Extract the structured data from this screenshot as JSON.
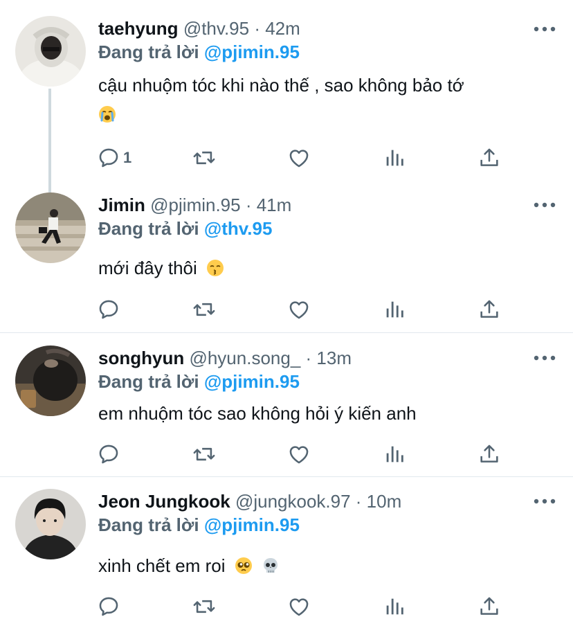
{
  "colors": {
    "link": "#1d9bf0",
    "secondary": "#536471",
    "text": "#0f1419",
    "divider": "#e1e8ed"
  },
  "reply_prefix": "Đang trả lời",
  "tweets": [
    {
      "name": "taehyung",
      "meta": "@thv.95 · 42m",
      "reply_to": "@pjimin.95",
      "text": "cậu nhuộm tóc khi nào thế , sao không bảo tớ",
      "emojis": [
        "crying-face"
      ],
      "reply_count": "1",
      "avatar": "avatar-taehyung"
    },
    {
      "name": "Jimin",
      "meta": "@pjimin.95 · 41m",
      "reply_to": "@thv.95",
      "text": "mới đây thôi",
      "emojis": [
        "kissing-face"
      ],
      "reply_count": "",
      "avatar": "avatar-jimin"
    },
    {
      "name": "songhyun",
      "meta": "@hyun.song_ · 13m",
      "reply_to": "@pjimin.95",
      "text": "em nhuộm tóc sao không hỏi ý kiến anh",
      "emojis": [],
      "reply_count": "",
      "avatar": "avatar-songhyun"
    },
    {
      "name": "Jeon Jungkook",
      "meta": "@jungkook.97 · 10m",
      "reply_to": "@pjimin.95",
      "text": "xinh chết em roi",
      "emojis": [
        "pleading-face",
        "skull"
      ],
      "reply_count": "",
      "avatar": "avatar-jungkook"
    }
  ],
  "icons": {
    "reply": "reply-icon",
    "retweet": "retweet-icon",
    "like": "heart-icon",
    "analytics": "analytics-icon",
    "share": "share-icon",
    "more": "more-icon"
  }
}
